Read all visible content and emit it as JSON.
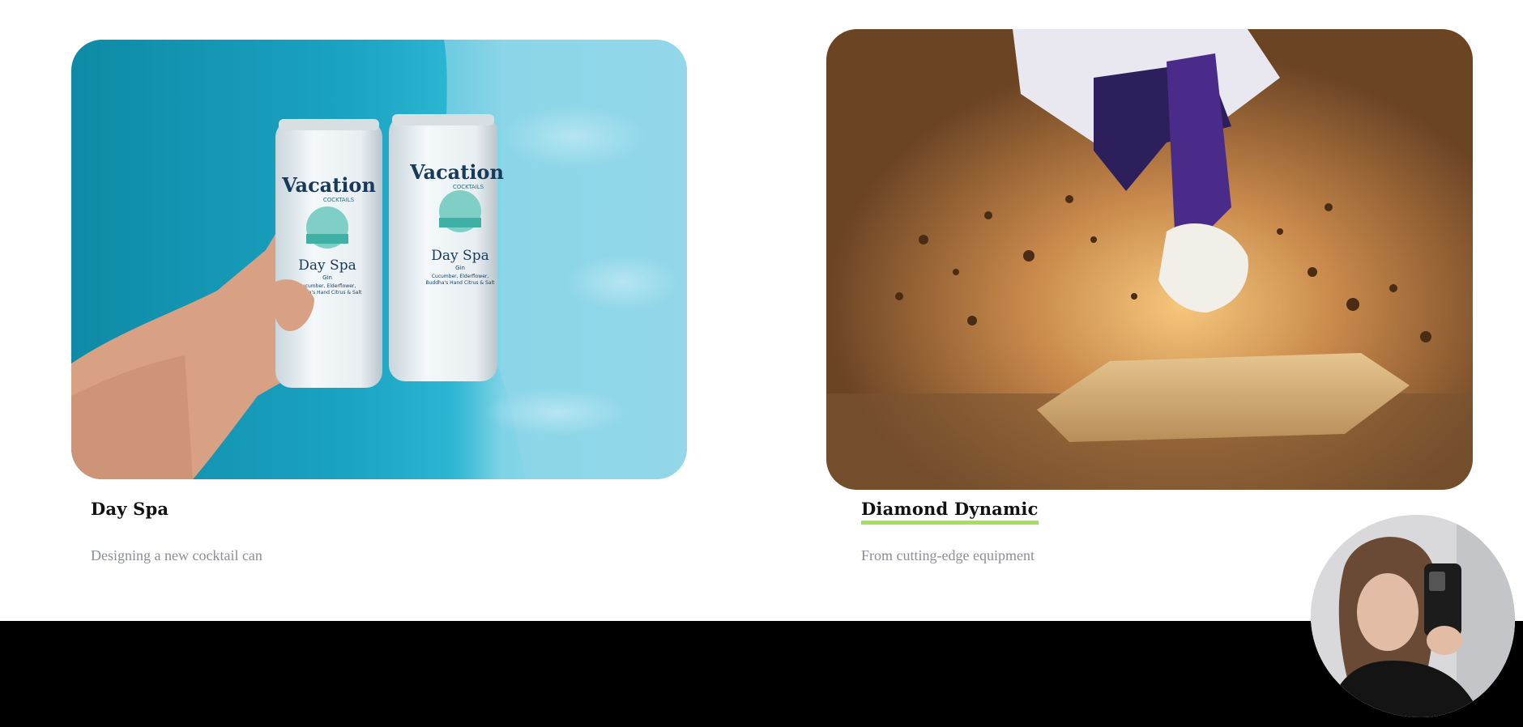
{
  "projects": [
    {
      "title": "Day Spa",
      "description": "Designing a new cocktail can",
      "image_alt": "Hand holding two Vacation Cocktails Day Spa cans over a pool",
      "can_brand": "Vacation",
      "can_sub": "COCKTAILS",
      "can_flavor": "Day Spa",
      "can_kind": "Gin",
      "can_notes_1": "Cucumber, Elderflower,",
      "can_notes_2": "Buddha's Hand Citrus & Salt"
    },
    {
      "title": "Diamond Dynamic",
      "description": "From cutting-edge equipment",
      "image_alt": "Baseball player sliding into base kicking up dirt"
    }
  ],
  "colors": {
    "accent_underline": "#a6e05a",
    "pool_blue": "#1fa6c4",
    "footer": "#000000"
  },
  "avatar": {
    "alt": "Person taking a mirror selfie"
  }
}
